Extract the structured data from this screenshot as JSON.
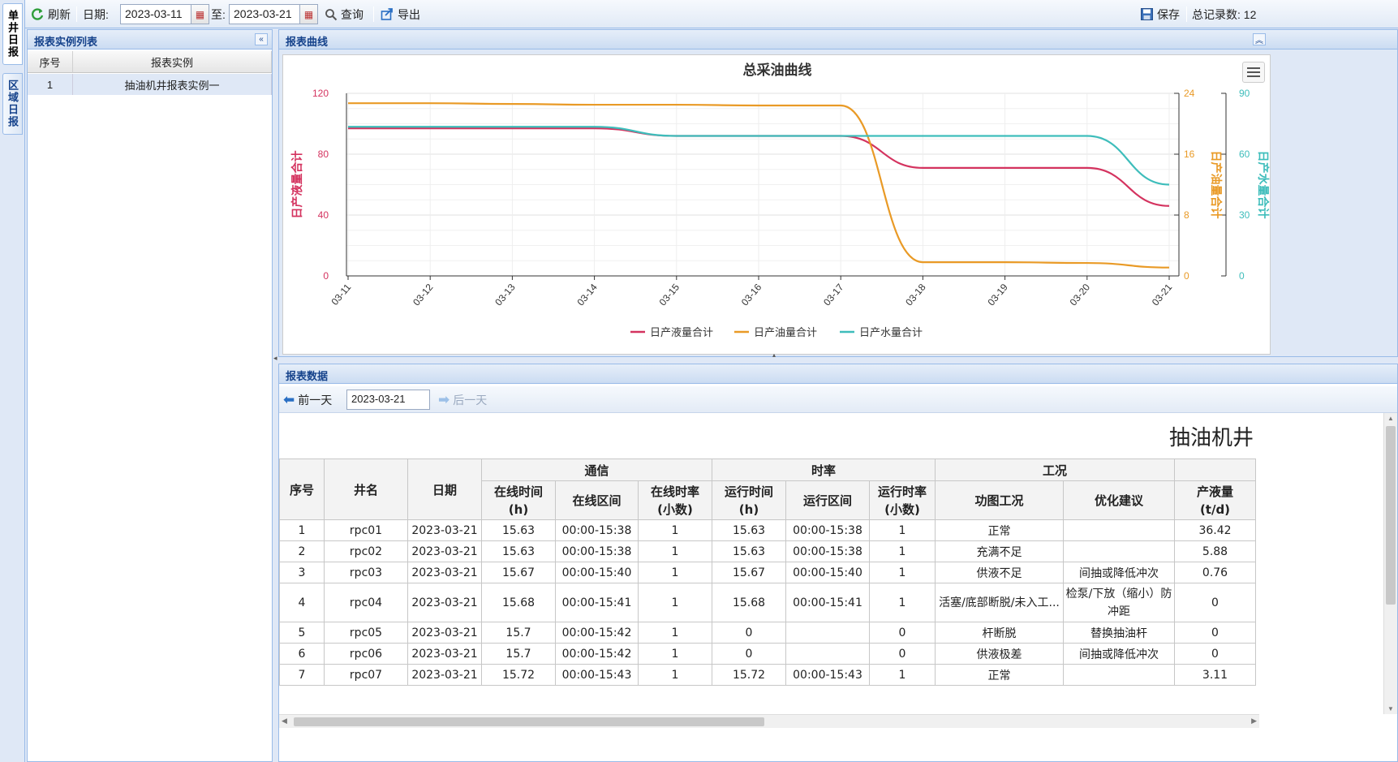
{
  "side_tabs": [
    "单井日报",
    "区域日报"
  ],
  "toolbar": {
    "refresh_label": "刷新",
    "date_label": "日期:",
    "date_from": "2023-03-11",
    "to_label": "至:",
    "date_to": "2023-03-21",
    "query_label": "查询",
    "export_label": "导出",
    "save_label": "保存",
    "total_label": "总记录数: 12"
  },
  "left_panel": {
    "title": "报表实例列表",
    "columns": [
      "序号",
      "报表实例"
    ],
    "rows": [
      {
        "no": "1",
        "name": "抽油机井报表实例一"
      }
    ]
  },
  "chart_panel": {
    "title": "报表曲线"
  },
  "chart_data": {
    "type": "line",
    "title": "总采油曲线",
    "categories": [
      "03-11",
      "03-12",
      "03-13",
      "03-14",
      "03-15",
      "03-16",
      "03-17",
      "03-18",
      "03-19",
      "03-20",
      "03-21"
    ],
    "series": [
      {
        "name": "日产液量合计",
        "color": "#d4335f",
        "axis": "left",
        "values": [
          97,
          97,
          97,
          97,
          92,
          92,
          92,
          71,
          71,
          71,
          46
        ]
      },
      {
        "name": "日产油量合计",
        "color": "#e99a26",
        "axis": "right1",
        "values": [
          22.7,
          22.7,
          22.6,
          22.5,
          22.5,
          22.4,
          22.4,
          1.8,
          1.8,
          1.7,
          1.1
        ]
      },
      {
        "name": "日产水量合计",
        "color": "#3ebdbb",
        "axis": "right2",
        "values": [
          73.5,
          73.5,
          73.5,
          73.5,
          69,
          69,
          69,
          69,
          69,
          69,
          45
        ]
      }
    ],
    "axes": {
      "left": {
        "label": "日产液量合计",
        "min": 0,
        "max": 120,
        "ticks": [
          0,
          40,
          80,
          120
        ],
        "color": "#d4335f"
      },
      "right1": {
        "label": "日产油量合计",
        "min": 0,
        "max": 24,
        "ticks": [
          0,
          8,
          16,
          24
        ],
        "color": "#e99a26"
      },
      "right2": {
        "label": "日产水量合计",
        "min": 0,
        "max": 90,
        "ticks": [
          0,
          30,
          60,
          90
        ],
        "color": "#3ebdbb"
      }
    },
    "grid": true,
    "legend": "bottom-center"
  },
  "data_panel": {
    "title": "报表数据",
    "prev_label": "前一天",
    "date": "2023-03-21",
    "next_label": "后一天",
    "report_title": "抽油机井",
    "group_headers": [
      "通信",
      "时率",
      "工况"
    ],
    "headers": {
      "no": "序号",
      "well": "井名",
      "date": "日期",
      "online_time": "在线时间\n(h)",
      "online_range": "在线区间",
      "online_rate": "在线时率\n(小数)",
      "run_time": "运行时间\n(h)",
      "run_range": "运行区间",
      "run_rate": "运行时率\n(小数)",
      "fdiag": "功图工况",
      "advice": "优化建议",
      "liquid": "产液量\n(t/d)"
    },
    "rows": [
      [
        "1",
        "rpc01",
        "2023-03-21",
        "15.63",
        "00:00-15:38",
        "1",
        "15.63",
        "00:00-15:38",
        "1",
        "正常",
        "",
        "36.42"
      ],
      [
        "2",
        "rpc02",
        "2023-03-21",
        "15.63",
        "00:00-15:38",
        "1",
        "15.63",
        "00:00-15:38",
        "1",
        "充满不足",
        "",
        "5.88"
      ],
      [
        "3",
        "rpc03",
        "2023-03-21",
        "15.67",
        "00:00-15:40",
        "1",
        "15.67",
        "00:00-15:40",
        "1",
        "供液不足",
        "间抽或降低冲次",
        "0.76"
      ],
      [
        "4",
        "rpc04",
        "2023-03-21",
        "15.68",
        "00:00-15:41",
        "1",
        "15.68",
        "00:00-15:41",
        "1",
        "活塞/底部断脱/未入工...",
        "检泵/下放（缩小）防冲距",
        "0"
      ],
      [
        "5",
        "rpc05",
        "2023-03-21",
        "15.7",
        "00:00-15:42",
        "1",
        "0",
        "",
        "0",
        "杆断脱",
        "替换抽油杆",
        "0"
      ],
      [
        "6",
        "rpc06",
        "2023-03-21",
        "15.7",
        "00:00-15:42",
        "1",
        "0",
        "",
        "0",
        "供液极差",
        "间抽或降低冲次",
        "0"
      ],
      [
        "7",
        "rpc07",
        "2023-03-21",
        "15.72",
        "00:00-15:43",
        "1",
        "15.72",
        "00:00-15:43",
        "1",
        "正常",
        "",
        "3.11"
      ]
    ]
  }
}
